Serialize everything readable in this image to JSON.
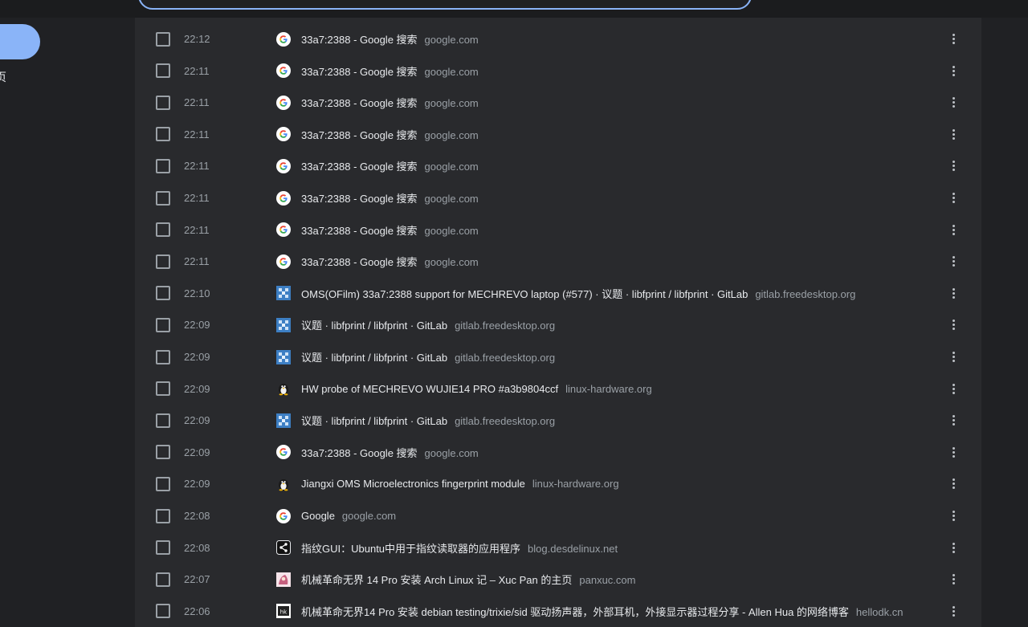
{
  "sidebar": {
    "active_item_label": "页"
  },
  "history": {
    "rows": [
      {
        "time": "22:12",
        "favicon": "google-icon",
        "title": "33a7:2388 - Google 搜索",
        "domain": "google.com"
      },
      {
        "time": "22:11",
        "favicon": "google-icon",
        "title": "33a7:2388 - Google 搜索",
        "domain": "google.com"
      },
      {
        "time": "22:11",
        "favicon": "google-icon",
        "title": "33a7:2388 - Google 搜索",
        "domain": "google.com"
      },
      {
        "time": "22:11",
        "favicon": "google-icon",
        "title": "33a7:2388 - Google 搜索",
        "domain": "google.com"
      },
      {
        "time": "22:11",
        "favicon": "google-icon",
        "title": "33a7:2388 - Google 搜索",
        "domain": "google.com"
      },
      {
        "time": "22:11",
        "favicon": "google-icon",
        "title": "33a7:2388 - Google 搜索",
        "domain": "google.com"
      },
      {
        "time": "22:11",
        "favicon": "google-icon",
        "title": "33a7:2388 - Google 搜索",
        "domain": "google.com"
      },
      {
        "time": "22:11",
        "favicon": "google-icon",
        "title": "33a7:2388 - Google 搜索",
        "domain": "google.com"
      },
      {
        "time": "22:10",
        "favicon": "gitlab-freedesktop-icon",
        "title": "OMS(OFilm) 33a7:2388 support for MECHREVO laptop (#577) · 议题 · libfprint / libfprint · GitLab",
        "domain": "gitlab.freedesktop.org"
      },
      {
        "time": "22:09",
        "favicon": "gitlab-freedesktop-icon",
        "title": "议题 · libfprint / libfprint · GitLab",
        "domain": "gitlab.freedesktop.org"
      },
      {
        "time": "22:09",
        "favicon": "gitlab-freedesktop-icon",
        "title": "议题 · libfprint / libfprint · GitLab",
        "domain": "gitlab.freedesktop.org"
      },
      {
        "time": "22:09",
        "favicon": "tux-penguin-icon",
        "title": "HW probe of MECHREVO WUJIE14 PRO #a3b9804ccf",
        "domain": "linux-hardware.org"
      },
      {
        "time": "22:09",
        "favicon": "gitlab-freedesktop-icon",
        "title": "议题 · libfprint / libfprint · GitLab",
        "domain": "gitlab.freedesktop.org"
      },
      {
        "time": "22:09",
        "favicon": "google-icon",
        "title": "33a7:2388 - Google 搜索",
        "domain": "google.com"
      },
      {
        "time": "22:09",
        "favicon": "tux-penguin-icon",
        "title": "Jiangxi OMS Microelectronics fingerprint module",
        "domain": "linux-hardware.org"
      },
      {
        "time": "22:08",
        "favicon": "google-icon",
        "title": "Google",
        "domain": "google.com"
      },
      {
        "time": "22:08",
        "favicon": "share-icon",
        "title": "指纹GUI：Ubuntu中用于指纹读取器的应用程序",
        "domain": "blog.desdelinux.net"
      },
      {
        "time": "22:07",
        "favicon": "pink-avatar-icon",
        "title": "机械革命无界 14 Pro 安装 Arch Linux 记 – Xuc Pan 的主页",
        "domain": "panxuc.com"
      },
      {
        "time": "22:06",
        "favicon": "hellodk-icon",
        "title": "机械革命无界14 Pro 安装 debian testing/trixie/sid 驱动扬声器，外部耳机，外接显示器过程分享 - Allen Hua 的网络博客",
        "domain": "hellodk.cn"
      }
    ]
  }
}
